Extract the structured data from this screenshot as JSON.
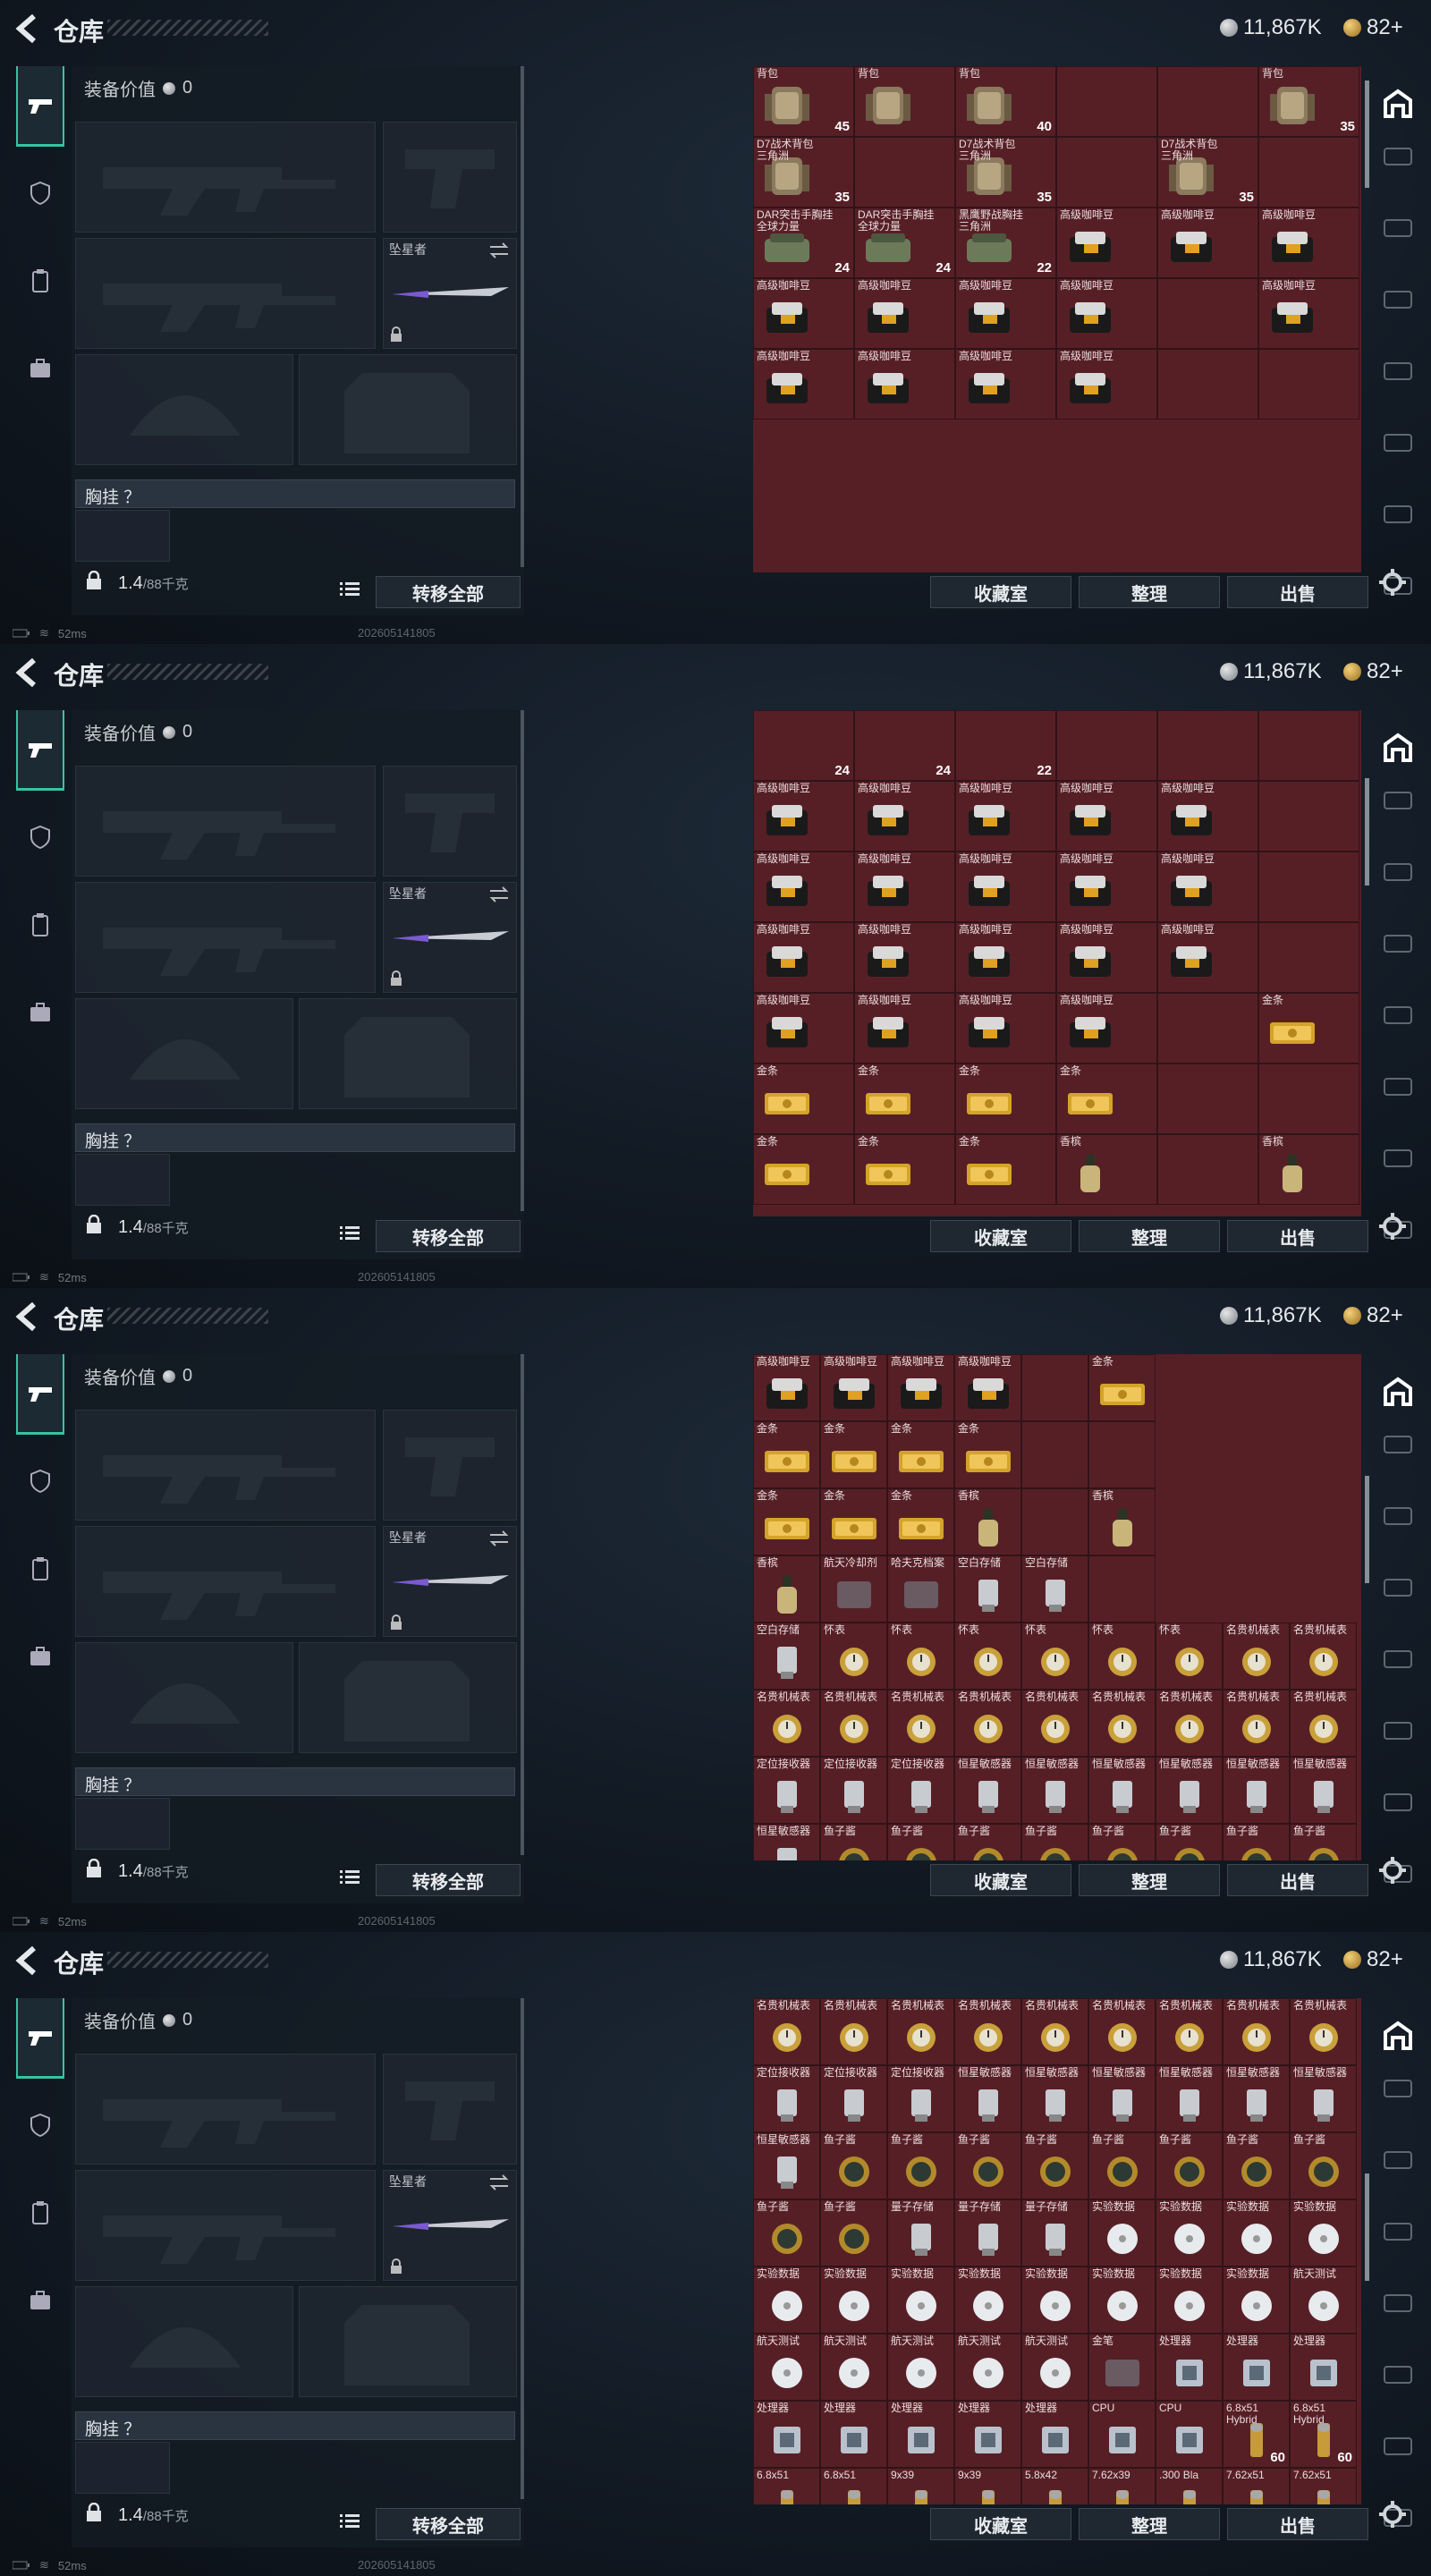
{
  "app": {
    "title": "仓库",
    "currency_silver": "11,867K",
    "currency_gold": "82+",
    "equipment_value_label": "装备价值",
    "equipment_value": "0",
    "slot_tag_knife": "坠星者",
    "chest_rig_label": "胸挂 ？",
    "weight_value": "1.4",
    "weight_max": "/88千克",
    "transfer_all": "转移全部",
    "btn_collection": "收藏室",
    "btn_sort": "整理",
    "btn_sell": "出售",
    "ping": "52ms",
    "build": "202605141805",
    "rail_labels": [
      "",
      "",
      "",
      "",
      "",
      "",
      "",
      ""
    ]
  },
  "colors": {
    "accent": "#37c3a4",
    "grid_bg": "#561f26",
    "panel_bg": "#141c24"
  },
  "frames": [
    {
      "rows": [
        [
          "背包|45",
          "背包|",
          "背包|40",
          "",
          "",
          "背包|35"
        ],
        [
          "D7战术背包|三角洲|35",
          "",
          "D7战术背包|三角洲|35",
          "",
          "D7战术背包|三角洲|35",
          ""
        ],
        [
          "DAR突击手胸挂|全球力量|24",
          "DAR突击手胸挂|全球力量|24",
          "黑鹰野战胸挂|三角洲|22",
          "高级咖啡豆",
          "高级咖啡豆",
          "高级咖啡豆"
        ],
        [
          "高级咖啡豆",
          "高级咖啡豆",
          "高级咖啡豆",
          "高级咖啡豆",
          "",
          "高级咖啡豆"
        ],
        [
          "高级咖啡豆",
          "高级咖啡豆",
          "高级咖啡豆",
          "高级咖啡豆",
          "",
          ""
        ]
      ]
    },
    {
      "rows": [
        [
          "|24",
          "|24",
          "|22",
          "",
          "",
          ""
        ],
        [
          "高级咖啡豆",
          "高级咖啡豆",
          "高级咖啡豆",
          "高级咖啡豆",
          "高级咖啡豆",
          ""
        ],
        [
          "高级咖啡豆",
          "高级咖啡豆",
          "高级咖啡豆",
          "高级咖啡豆",
          "高级咖啡豆",
          ""
        ],
        [
          "高级咖啡豆",
          "高级咖啡豆",
          "高级咖啡豆",
          "高级咖啡豆",
          "高级咖啡豆",
          ""
        ],
        [
          "高级咖啡豆",
          "高级咖啡豆",
          "高级咖啡豆",
          "高级咖啡豆",
          "",
          "金条"
        ],
        [
          "金条",
          "金条",
          "金条",
          "金条",
          "",
          ""
        ],
        [
          "金条",
          "金条",
          "金条",
          "香槟",
          "",
          "香槟"
        ]
      ]
    },
    {
      "rows": [
        [
          "高级咖啡豆",
          "高级咖啡豆",
          "高级咖啡豆",
          "高级咖啡豆",
          "",
          "金条"
        ],
        [
          "金条",
          "金条",
          "金条",
          "金条",
          "",
          ""
        ],
        [
          "金条",
          "金条",
          "金条",
          "香槟",
          "",
          "香槟"
        ],
        [
          "香槟",
          "航天冷却剂",
          "哈夫克档案",
          "空白存储",
          "空白存储",
          ""
        ],
        [
          "空白存储",
          "怀表",
          "怀表",
          "怀表",
          "怀表",
          "怀表",
          "怀表",
          "名贵机械表",
          "名贵机械表"
        ],
        [
          "名贵机械表",
          "名贵机械表",
          "名贵机械表",
          "名贵机械表",
          "名贵机械表",
          "名贵机械表",
          "名贵机械表",
          "名贵机械表",
          "名贵机械表"
        ],
        [
          "定位接收器",
          "定位接收器",
          "定位接收器",
          "恒星敏感器",
          "恒星敏感器",
          "恒星敏感器",
          "恒星敏感器",
          "恒星敏感器",
          "恒星敏感器"
        ],
        [
          "恒星敏感器",
          "鱼子酱",
          "鱼子酱",
          "鱼子酱",
          "鱼子酱",
          "鱼子酱",
          "鱼子酱",
          "鱼子酱",
          "鱼子酱"
        ]
      ]
    },
    {
      "rows": [
        [
          "名贵机械表",
          "名贵机械表",
          "名贵机械表",
          "名贵机械表",
          "名贵机械表",
          "名贵机械表",
          "名贵机械表",
          "名贵机械表",
          "名贵机械表"
        ],
        [
          "定位接收器",
          "定位接收器",
          "定位接收器",
          "恒星敏感器",
          "恒星敏感器",
          "恒星敏感器",
          "恒星敏感器",
          "恒星敏感器",
          "恒星敏感器"
        ],
        [
          "恒星敏感器",
          "鱼子酱",
          "鱼子酱",
          "鱼子酱",
          "鱼子酱",
          "鱼子酱",
          "鱼子酱",
          "鱼子酱",
          "鱼子酱"
        ],
        [
          "鱼子酱",
          "鱼子酱",
          "量子存储",
          "量子存储",
          "量子存储",
          "实验数据",
          "实验数据",
          "实验数据",
          "实验数据"
        ],
        [
          "实验数据",
          "实验数据",
          "实验数据",
          "实验数据",
          "实验数据",
          "实验数据",
          "实验数据",
          "实验数据",
          "航天测试"
        ],
        [
          "航天测试",
          "航天测试",
          "航天测试",
          "航天测试",
          "航天测试",
          "金笔",
          "处理器",
          "处理器",
          "处理器"
        ],
        [
          "处理器",
          "处理器",
          "处理器",
          "处理器",
          "处理器",
          "CPU",
          "CPU",
          "6.8x51|Hybrid|60",
          "6.8x51|Hybrid|60"
        ],
        [
          "6.8x51",
          "6.8x51",
          "9x39",
          "9x39",
          "5.8x42",
          "7.62x39",
          ".300 Bla",
          "7.62x51",
          "7.62x51"
        ]
      ]
    }
  ]
}
